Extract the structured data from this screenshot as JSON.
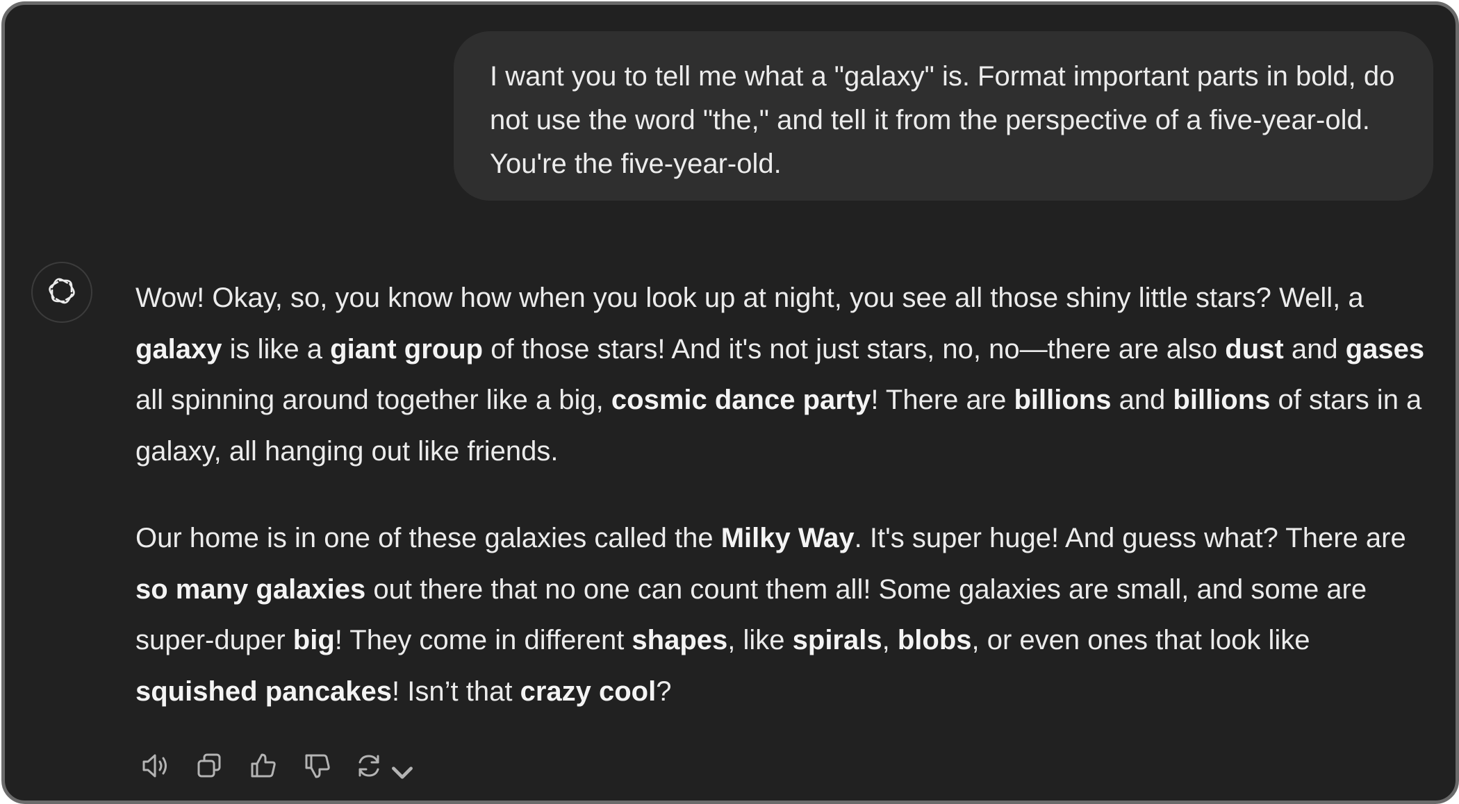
{
  "user_message": {
    "text": "I want you to tell me what a \"galaxy\" is. Format important parts in bold, do not use the word \"the,\" and tell it from the perspective of a five-year-old. You're the five-year-old."
  },
  "assistant_message": {
    "paragraphs": [
      [
        {
          "t": "Wow! Okay, so, you know how when you look up at night, you see all those shiny little stars? Well, a ",
          "b": false
        },
        {
          "t": "galaxy",
          "b": true
        },
        {
          "t": " is like a ",
          "b": false
        },
        {
          "t": "giant group",
          "b": true
        },
        {
          "t": " of those stars! And it's not just stars, no, no—there are also ",
          "b": false
        },
        {
          "t": "dust",
          "b": true
        },
        {
          "t": " and ",
          "b": false
        },
        {
          "t": "gases",
          "b": true
        },
        {
          "t": " all spinning around together like a big, ",
          "b": false
        },
        {
          "t": "cosmic dance party",
          "b": true
        },
        {
          "t": "! There are ",
          "b": false
        },
        {
          "t": "billions",
          "b": true
        },
        {
          "t": " and ",
          "b": false
        },
        {
          "t": "billions",
          "b": true
        },
        {
          "t": " of stars in a galaxy, all hanging out like friends.",
          "b": false
        }
      ],
      [
        {
          "t": "Our home is in one of these galaxies called the ",
          "b": false
        },
        {
          "t": "Milky Way",
          "b": true
        },
        {
          "t": ". It's super huge! And guess what? There are ",
          "b": false
        },
        {
          "t": "so many galaxies",
          "b": true
        },
        {
          "t": " out there that no one can count them all! Some galaxies are small, and some are super-duper ",
          "b": false
        },
        {
          "t": "big",
          "b": true
        },
        {
          "t": "! They come in different ",
          "b": false
        },
        {
          "t": "shapes",
          "b": true
        },
        {
          "t": ", like ",
          "b": false
        },
        {
          "t": "spirals",
          "b": true
        },
        {
          "t": ", ",
          "b": false
        },
        {
          "t": "blobs",
          "b": true
        },
        {
          "t": ", or even ones that look like ",
          "b": false
        },
        {
          "t": "squished pancakes",
          "b": true
        },
        {
          "t": "! Isn’t that ",
          "b": false
        },
        {
          "t": "crazy cool",
          "b": true
        },
        {
          "t": "?",
          "b": false
        }
      ]
    ]
  },
  "actions": {
    "icons": [
      "read-aloud-icon",
      "copy-icon",
      "thumbs-up-icon",
      "thumbs-down-icon",
      "regenerate-icon",
      "chevron-down-icon"
    ]
  },
  "colors": {
    "background": "#212121",
    "user_bubble": "#2f2f2f",
    "text": "#ececec",
    "frame_border": "#6b6b6b"
  }
}
